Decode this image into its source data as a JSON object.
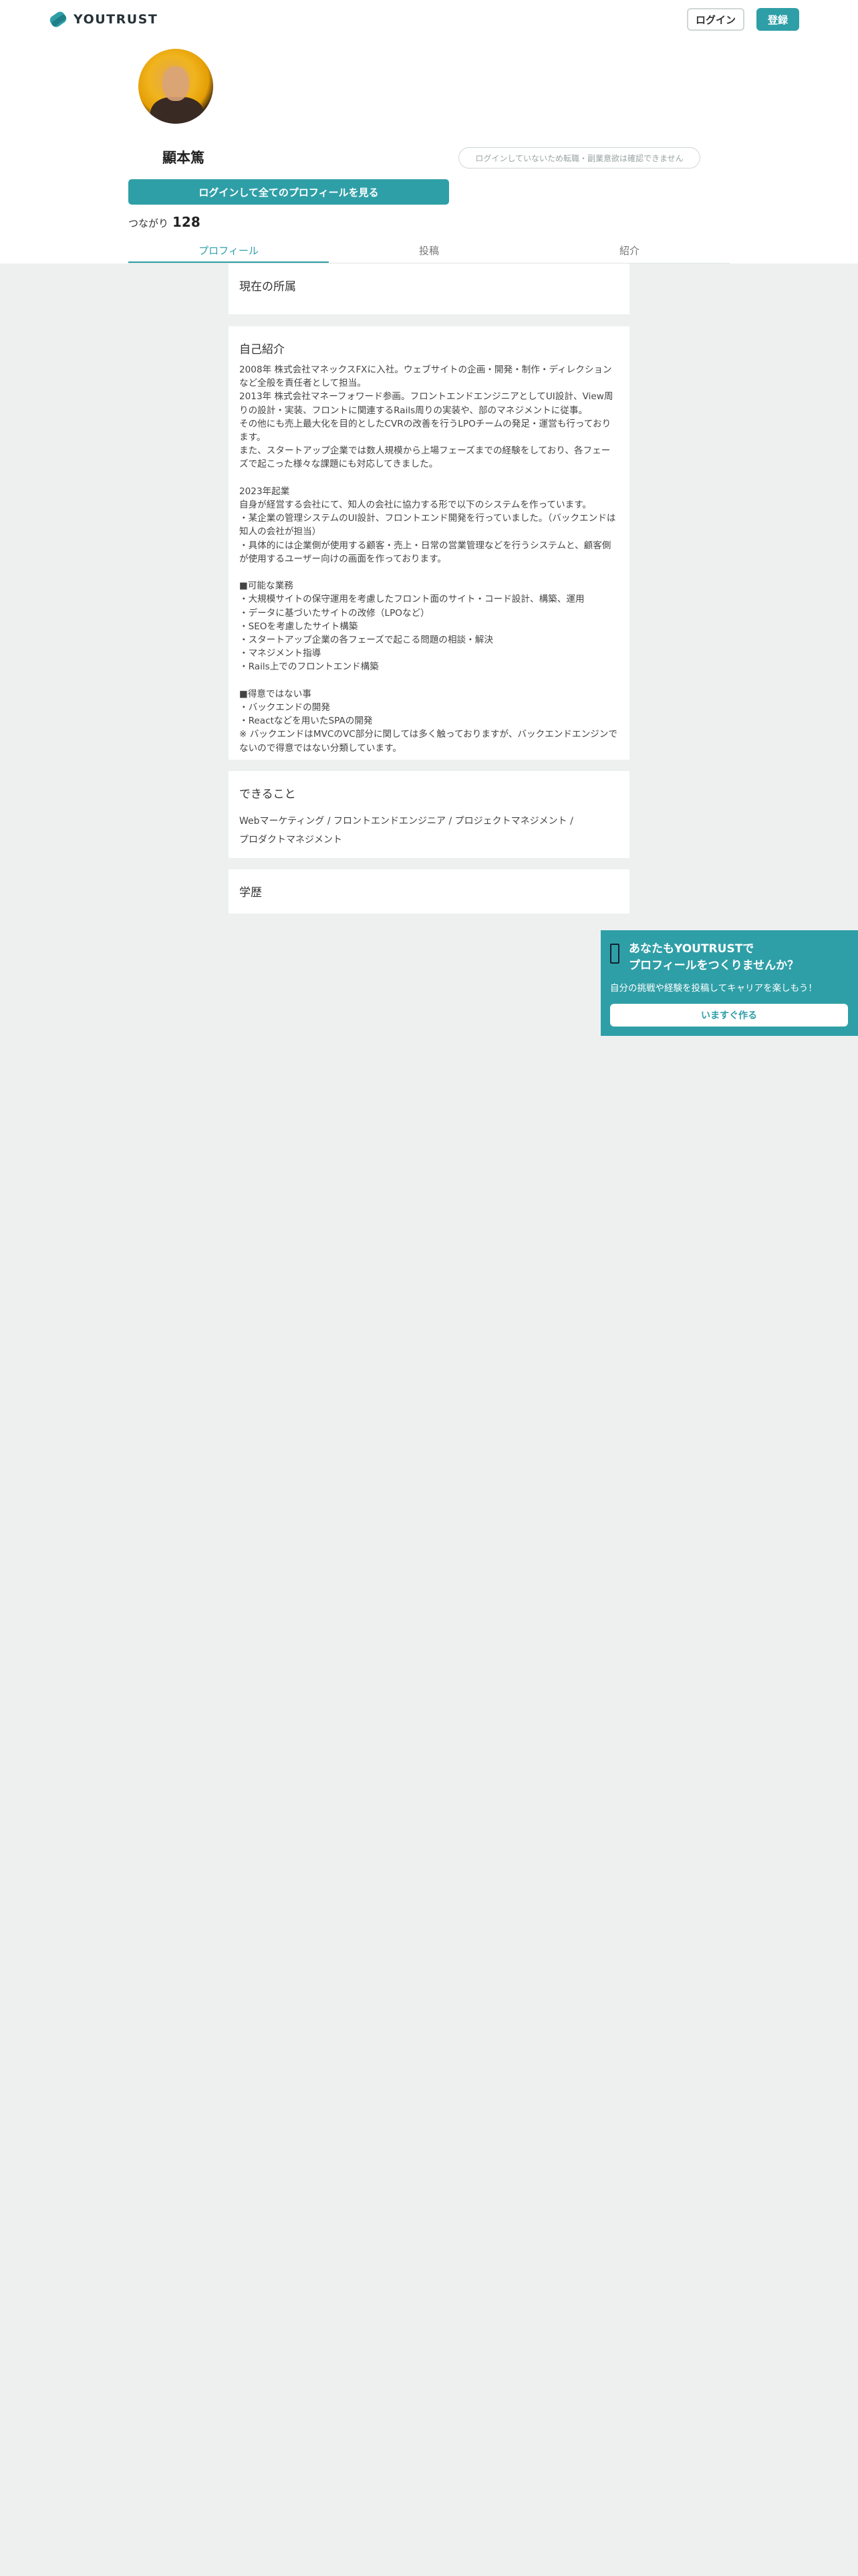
{
  "header": {
    "logo_text": "YOUTRUST",
    "login_label": "ログイン",
    "register_label": "登録"
  },
  "profile": {
    "name": "顯本篤",
    "notice": "ログインしていないため転職・副業意欲は確認できません",
    "cta_label": "ログインして全てのプロフィールを見る",
    "connections_label": "つながり",
    "connections_count": "128"
  },
  "tabs": [
    {
      "label": "プロフィール",
      "active": true
    },
    {
      "label": "投稿",
      "active": false
    },
    {
      "label": "紹介",
      "active": false
    }
  ],
  "sections": {
    "current_title": "現在の所属",
    "intro_title": "自己紹介",
    "intro_text": "2008年 株式会社マネックスFXに入社。ウェブサイトの企画・開発・制作・ディレクションなど全般を責任者として担当。\n2013年 株式会社マネーフォワード参画。フロントエンドエンジニアとしてUI設計、View周りの設計・実装、フロントに関連するRails周りの実装や、部のマネジメントに従事。\nその他にも売上最大化を目的としたCVRの改善を行うLPOチームの発足・運営も行っております。\nまた、スタートアップ企業では数人規模から上場フェーズまでの経験をしており、各フェーズで起こった様々な課題にも対応してきました。\n\n2023年起業\n自身が経営する会社にて、知人の会社に協力する形で以下のシステムを作っています。\n・某企業の管理システムのUI設計、フロントエンド開発を行っていました。（バックエンドは知人の会社が担当）\n・具体的には企業側が使用する顧客・売上・日常の営業管理などを行うシステムと、顧客側が使用するユーザー向けの画面を作っております。\n\n■可能な業務\n・大規模サイトの保守運用を考慮したフロント面のサイト・コード設計、構築、運用\n・データに基づいたサイトの改修（LPOなど）\n・SEOを考慮したサイト構築\n・スタートアップ企業の各フェーズで起こる問題の相談・解決\n・マネジメント指導\n・Rails上でのフロントエンド構築\n\n■得意ではない事\n・バックエンドの開発\n・Reactなどを用いたSPAの開発\n※ バックエンドはMVCのVC部分に関しては多く触っておりますが、バックエンドエンジンでないので得意ではない分類しています。",
    "skills_title": "できること",
    "skills_line1": "Webマーケティング / フロントエンドエンジニア / プロジェクトマネジメント /",
    "skills_line2": "プロダクトマネジメント",
    "education_title": "学歴"
  },
  "banner": {
    "title_line1": "あなたもYOUTRUSTで",
    "title_line2": "プロフィールをつくりませんか？",
    "subtitle": "自分の挑戦や経験を投稿してキャリアを楽しもう！",
    "button_label": "いますぐ作る"
  },
  "colors": {
    "accent": "#2f9fa7",
    "background": "#eef0f0"
  }
}
